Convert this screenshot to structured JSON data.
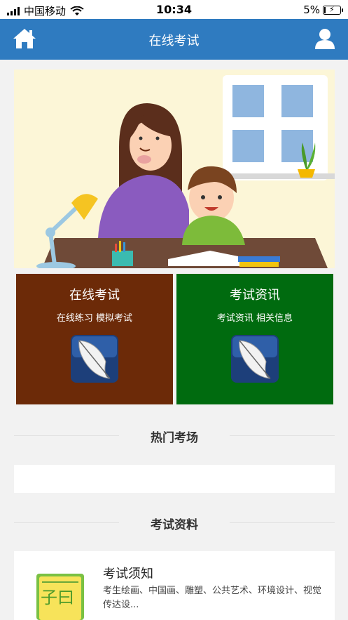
{
  "status_bar": {
    "carrier": "中国移动",
    "time": "10:34",
    "battery": "5%"
  },
  "navbar": {
    "title": "在线考试"
  },
  "tiles": [
    {
      "title": "在线考试",
      "subtitle": "在线练习 模拟考试",
      "bg": "#6c2a08"
    },
    {
      "title": "考试资讯",
      "subtitle": "考试资讯 相关信息",
      "bg": "#006b0f"
    }
  ],
  "sections": {
    "hot": "热门考场",
    "materials": "考试资料"
  },
  "card": {
    "title": "考试须知",
    "desc": "考生绘画、中国画、雕塑、公共艺术、环境设计、视觉传达设...",
    "thumb_text": "子曰"
  },
  "colors": {
    "nav": "#2f7bc0",
    "tile_brown": "#6c2a08",
    "tile_green": "#006b0f"
  },
  "icons": [
    "signal-icon",
    "wifi-icon",
    "battery-icon",
    "home-icon",
    "user-icon",
    "feather-icon"
  ]
}
